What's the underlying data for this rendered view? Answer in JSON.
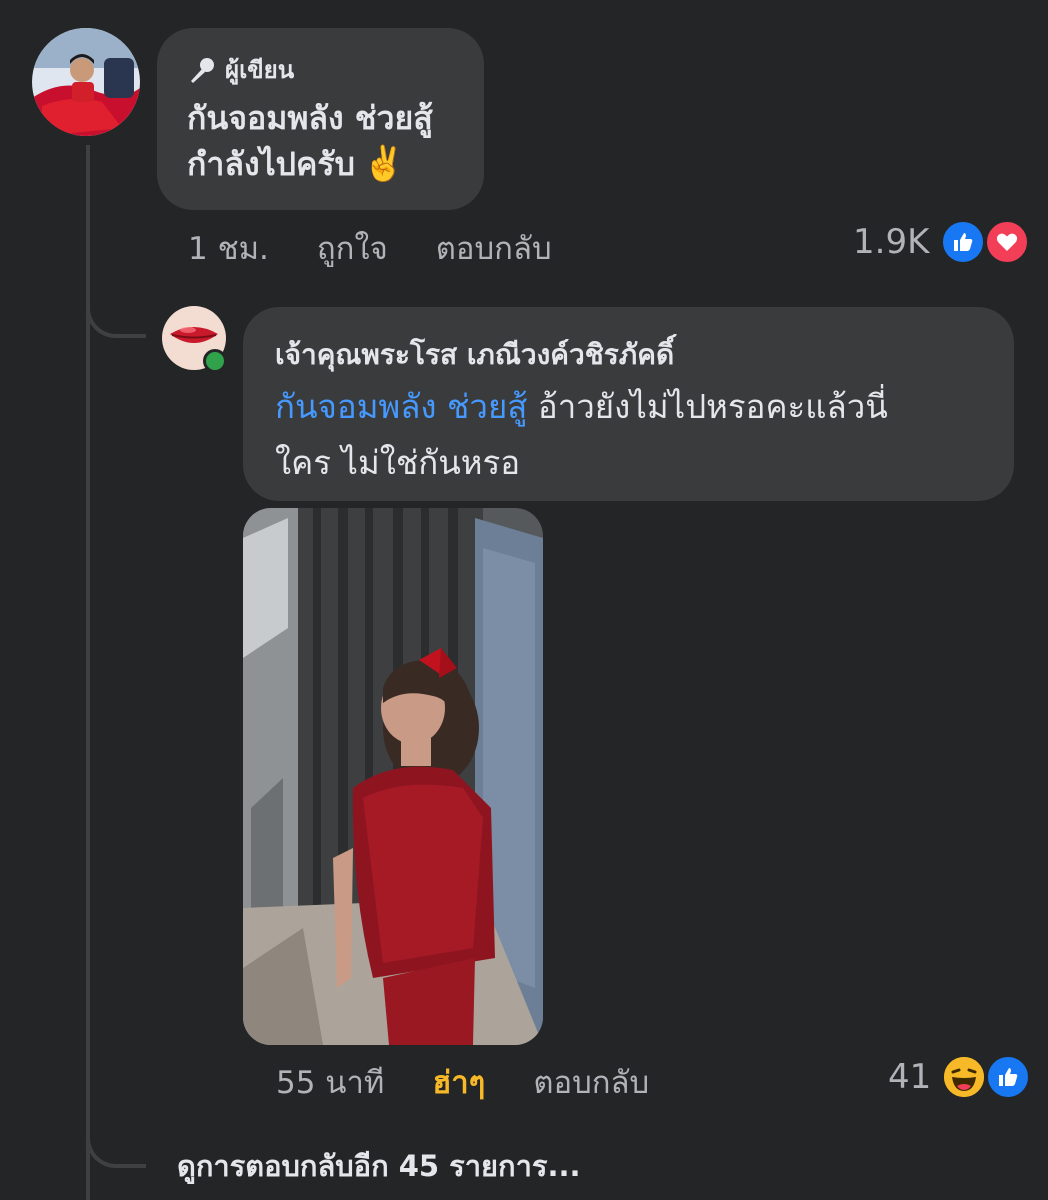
{
  "comment1": {
    "author_badge": "ผู้เขียน",
    "badge_icon": "microphone-icon",
    "text_line1": "กันจอมพลัง ช่วยสู้",
    "text_line2": "กำลังไปครับ",
    "emoji": "✌️",
    "time": "1 ชม.",
    "like_label": "ถูกใจ",
    "reply_label": "ตอบกลับ",
    "reaction_count": "1.9K",
    "reactions": [
      "like-icon",
      "love-icon"
    ],
    "avatar_color": "#c8102e"
  },
  "comment2": {
    "author_name": "เจ้าคุณพระโรส เภณีวงค์วชิรภัคดิ์",
    "mention": "กันจอมพลัง ช่วยสู้",
    "text_after_mention": " อ้าวยังไม่ไปหรอคะแล้วนี่",
    "text_line2": "ใคร ไม่ใช่กันหรอ",
    "online": true,
    "time": "55 นาที",
    "reaction_label": "ฮ่าๆ",
    "reply_label": "ตอบกลับ",
    "reaction_count": "41",
    "reactions": [
      "haha-icon",
      "like-icon"
    ],
    "media": "photo of person in red dress with red hair bow"
  },
  "view_more": "ดูการตอบกลับอีก 45 รายการ...",
  "colors": {
    "background": "#242526",
    "bubble": "#3a3b3c",
    "mention": "#4599ff",
    "haha_active": "#f7b928",
    "like_blue": "#1877f2",
    "love_red": "#f33e58",
    "online_green": "#31a24c"
  }
}
